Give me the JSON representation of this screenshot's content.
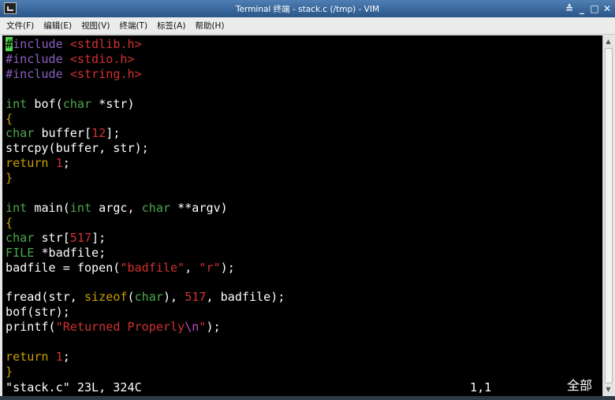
{
  "window": {
    "title": "Terminal 终端 - stack.c (/tmp) - VIM",
    "controls": [
      "≙",
      "_",
      "□",
      "✕"
    ]
  },
  "menu": [
    "文件(F)",
    "编辑(E)",
    "视图(V)",
    "终端(T)",
    "标签(A)",
    "帮助(H)"
  ],
  "editor": {
    "lines": [
      [
        {
          "t": "#",
          "c": "cursor"
        },
        {
          "t": "include ",
          "c": "kw-pre"
        },
        {
          "t": "<stdlib.h>",
          "c": "str"
        }
      ],
      [
        {
          "t": "#include ",
          "c": "kw-pre"
        },
        {
          "t": "<stdio.h>",
          "c": "str"
        }
      ],
      [
        {
          "t": "#include ",
          "c": "kw-pre"
        },
        {
          "t": "<string.h>",
          "c": "str"
        }
      ],
      [],
      [
        {
          "t": "int",
          "c": "kw-type"
        },
        {
          "t": " bof("
        },
        {
          "t": "char",
          "c": "kw-type"
        },
        {
          "t": " *str)"
        }
      ],
      [
        {
          "t": "{",
          "c": "brace"
        }
      ],
      [
        {
          "t": "char",
          "c": "kw-type"
        },
        {
          "t": " buffer["
        },
        {
          "t": "12",
          "c": "num"
        },
        {
          "t": "];"
        }
      ],
      [
        {
          "t": "strcpy(buffer, str);"
        }
      ],
      [
        {
          "t": "return",
          "c": "kw-ctrl"
        },
        {
          "t": " "
        },
        {
          "t": "1",
          "c": "num"
        },
        {
          "t": ";"
        }
      ],
      [
        {
          "t": "}",
          "c": "brace"
        }
      ],
      [],
      [
        {
          "t": "int",
          "c": "kw-type"
        },
        {
          "t": " main("
        },
        {
          "t": "int",
          "c": "kw-type"
        },
        {
          "t": " argc, "
        },
        {
          "t": "char",
          "c": "kw-type"
        },
        {
          "t": " **argv)"
        }
      ],
      [
        {
          "t": "{",
          "c": "brace"
        }
      ],
      [
        {
          "t": "char",
          "c": "kw-type"
        },
        {
          "t": " str["
        },
        {
          "t": "517",
          "c": "num"
        },
        {
          "t": "];"
        }
      ],
      [
        {
          "t": "FILE",
          "c": "kw-type"
        },
        {
          "t": " *badfile;"
        }
      ],
      [
        {
          "t": "badfile = fopen("
        },
        {
          "t": "\"badfile\"",
          "c": "str"
        },
        {
          "t": ", "
        },
        {
          "t": "\"r\"",
          "c": "str"
        },
        {
          "t": ");"
        }
      ],
      [],
      [
        {
          "t": "fread(str, "
        },
        {
          "t": "sizeof",
          "c": "kw-ctrl"
        },
        {
          "t": "("
        },
        {
          "t": "char",
          "c": "kw-type"
        },
        {
          "t": "), "
        },
        {
          "t": "517",
          "c": "num"
        },
        {
          "t": ", badfile);"
        }
      ],
      [
        {
          "t": "bof(str);"
        }
      ],
      [
        {
          "t": "printf("
        },
        {
          "t": "\"Returned Properly",
          "c": "str"
        },
        {
          "t": "\\n",
          "c": "esc"
        },
        {
          "t": "\"",
          "c": "str"
        },
        {
          "t": ");"
        }
      ],
      [],
      [
        {
          "t": "return",
          "c": "kw-ctrl"
        },
        {
          "t": " "
        },
        {
          "t": "1",
          "c": "num"
        },
        {
          "t": ";"
        }
      ],
      [
        {
          "t": "}",
          "c": "brace"
        }
      ]
    ],
    "status_file": "\"stack.c\" 23L, 324C",
    "status_position": "1,1",
    "status_percent": "全部"
  },
  "scrollbar": {
    "up_icon": "▲",
    "down_icon": "▼"
  }
}
